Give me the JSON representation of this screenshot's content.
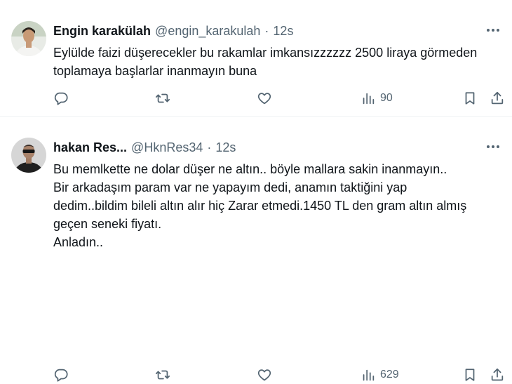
{
  "tweets": [
    {
      "name": "Engin karakülah",
      "handle": "@engin_karakulah",
      "dot": "·",
      "time": "12s",
      "text": "Eylülde faizi düşerecekler bu rakamlar imkansızzzzzz 2500 liraya görmeden\ntoplamaya başlarlar inanmayın buna",
      "views": "90"
    },
    {
      "name": "hakan Res...",
      "handle": "@HknRes34",
      "dot": "·",
      "time": "12s",
      "text": "Bu memlkette ne dolar düşer ne altın.. böyle mallara sakin inanmayın..\nBir arkadaşım param var ne yapayım dedi, anamın taktiğini yap\ndedim..bildim bileli altın alır hiç Zarar etmedi.1450 TL den gram altın almış\ngeçen seneki fiyatı.\nAnladın..",
      "views": "629"
    }
  ],
  "icons": {
    "reply": "reply-icon",
    "retweet": "retweet-icon",
    "like": "heart-icon",
    "views": "views-chart-icon",
    "bookmark": "bookmark-icon",
    "share": "share-icon",
    "more": "more-dots-icon"
  },
  "colors": {
    "text": "#0f1419",
    "secondary": "#536471",
    "divider": "#eff3f4"
  }
}
